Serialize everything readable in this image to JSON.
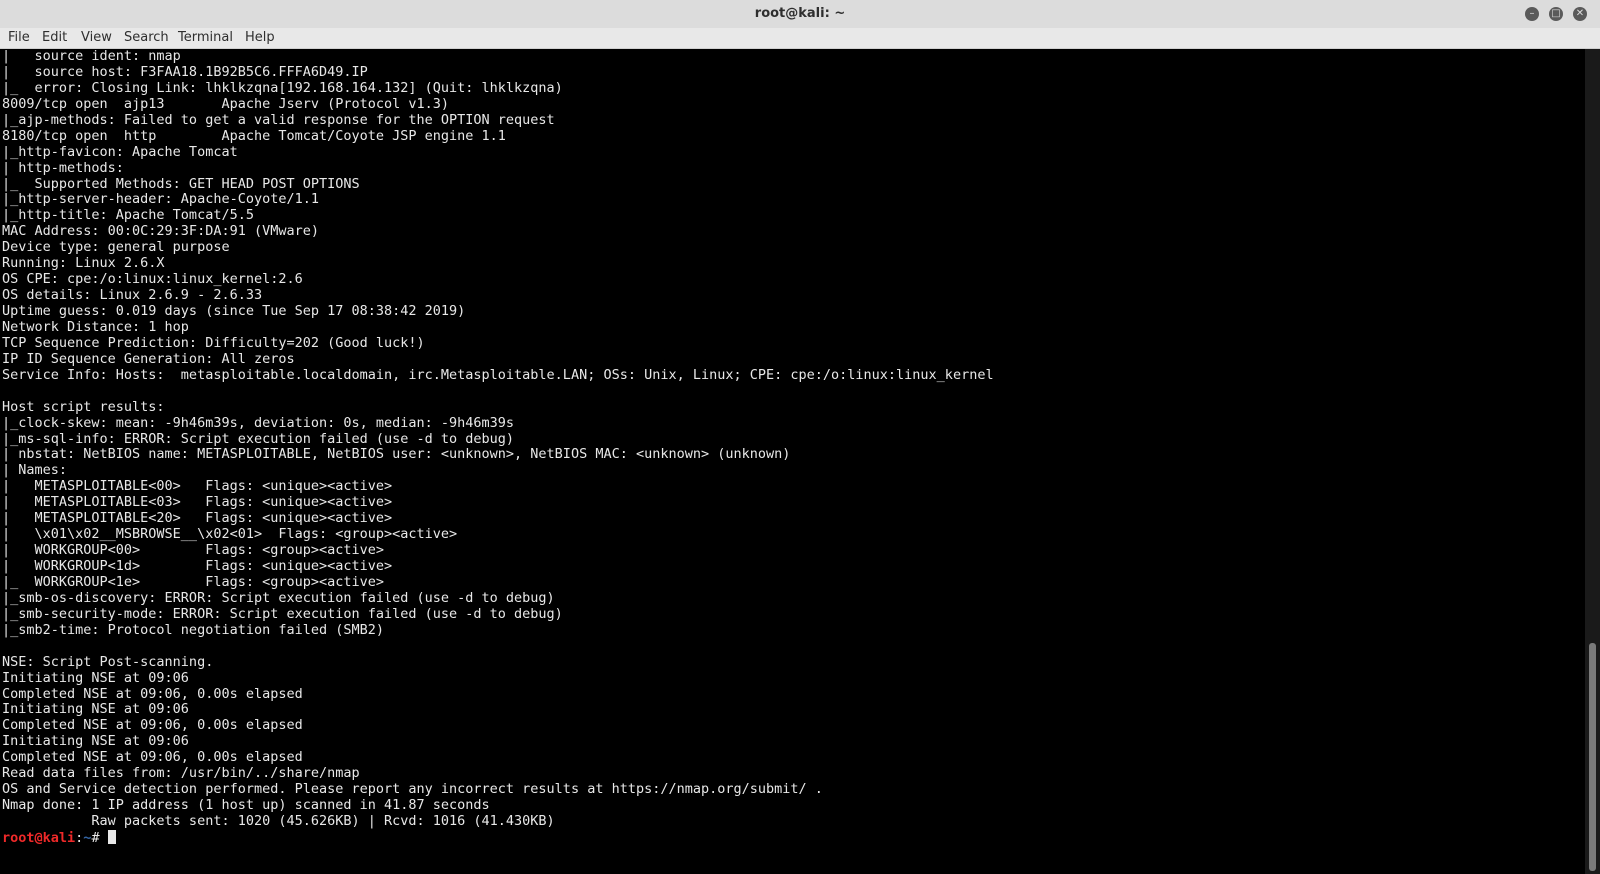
{
  "window": {
    "title": "root@kali: ~"
  },
  "window_controls": {
    "minimize": "–",
    "maximize": "□",
    "close": "✕"
  },
  "menu": [
    "File",
    "Edit",
    "View",
    "Search",
    "Terminal",
    "Help"
  ],
  "terminal": {
    "lines": [
      "|   source ident: nmap",
      "|   source host: F3FAA18.1B92B5C6.FFFA6D49.IP",
      "|_  error: Closing Link: lhklkzqna[192.168.164.132] (Quit: lhklkzqna)",
      "8009/tcp open  ajp13       Apache Jserv (Protocol v1.3)",
      "|_ajp-methods: Failed to get a valid response for the OPTION request",
      "8180/tcp open  http        Apache Tomcat/Coyote JSP engine 1.1",
      "|_http-favicon: Apache Tomcat",
      "| http-methods:",
      "|_  Supported Methods: GET HEAD POST OPTIONS",
      "|_http-server-header: Apache-Coyote/1.1",
      "|_http-title: Apache Tomcat/5.5",
      "MAC Address: 00:0C:29:3F:DA:91 (VMware)",
      "Device type: general purpose",
      "Running: Linux 2.6.X",
      "OS CPE: cpe:/o:linux:linux_kernel:2.6",
      "OS details: Linux 2.6.9 - 2.6.33",
      "Uptime guess: 0.019 days (since Tue Sep 17 08:38:42 2019)",
      "Network Distance: 1 hop",
      "TCP Sequence Prediction: Difficulty=202 (Good luck!)",
      "IP ID Sequence Generation: All zeros",
      "Service Info: Hosts:  metasploitable.localdomain, irc.Metasploitable.LAN; OSs: Unix, Linux; CPE: cpe:/o:linux:linux_kernel",
      "",
      "Host script results:",
      "|_clock-skew: mean: -9h46m39s, deviation: 0s, median: -9h46m39s",
      "|_ms-sql-info: ERROR: Script execution failed (use -d to debug)",
      "| nbstat: NetBIOS name: METASPLOITABLE, NetBIOS user: <unknown>, NetBIOS MAC: <unknown> (unknown)",
      "| Names:",
      "|   METASPLOITABLE<00>   Flags: <unique><active>",
      "|   METASPLOITABLE<03>   Flags: <unique><active>",
      "|   METASPLOITABLE<20>   Flags: <unique><active>",
      "|   \\x01\\x02__MSBROWSE__\\x02<01>  Flags: <group><active>",
      "|   WORKGROUP<00>        Flags: <group><active>",
      "|   WORKGROUP<1d>        Flags: <unique><active>",
      "|_  WORKGROUP<1e>        Flags: <group><active>",
      "|_smb-os-discovery: ERROR: Script execution failed (use -d to debug)",
      "|_smb-security-mode: ERROR: Script execution failed (use -d to debug)",
      "|_smb2-time: Protocol negotiation failed (SMB2)",
      "",
      "NSE: Script Post-scanning.",
      "Initiating NSE at 09:06",
      "Completed NSE at 09:06, 0.00s elapsed",
      "Initiating NSE at 09:06",
      "Completed NSE at 09:06, 0.00s elapsed",
      "Initiating NSE at 09:06",
      "Completed NSE at 09:06, 0.00s elapsed",
      "Read data files from: /usr/bin/../share/nmap",
      "OS and Service detection performed. Please report any incorrect results at https://nmap.org/submit/ .",
      "Nmap done: 1 IP address (1 host up) scanned in 41.87 seconds",
      "           Raw packets sent: 1020 (45.626KB) | Rcvd: 1016 (41.430KB)"
    ],
    "prompt": {
      "user_host": "root@kali",
      "separator": ":",
      "path": "~",
      "symbol": "# "
    }
  }
}
